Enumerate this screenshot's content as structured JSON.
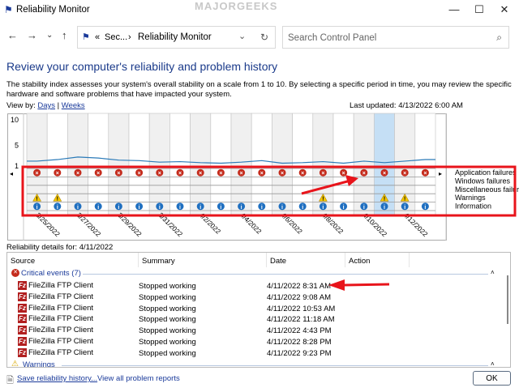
{
  "window": {
    "title": "Reliability Monitor",
    "minimize": "—",
    "maximize": "☐",
    "close": "✕",
    "watermark": "MAJORGEEKS .COM"
  },
  "nav": {
    "back": "←",
    "forward": "→",
    "recent": "⌄",
    "up": "↑",
    "breadcrumb_root": "«",
    "breadcrumb_parent": "Sec...",
    "breadcrumb_sep": "›",
    "breadcrumb_current": "Reliability Monitor",
    "dropdown": "⌄",
    "refresh": "↻",
    "search_placeholder": "Search Control Panel",
    "search_icon": "⌕"
  },
  "main": {
    "heading": "Review your computer's reliability and problem history",
    "description": "The stability index assesses your system's overall stability on a scale from 1 to 10. By selecting a specific period in time, you may review the specific hardware and software problems that have impacted your system.",
    "view_by_label": "View by:",
    "view_days": "Days",
    "view_sep": "|",
    "view_weeks": "Weeks",
    "last_updated": "Last updated: 4/13/2022 6:00 AM"
  },
  "chart_data": {
    "type": "line",
    "y_ticks": [
      "10",
      "5",
      "1"
    ],
    "ylim": [
      1,
      10
    ],
    "dates": [
      "3/25/2022",
      "3/26/2022",
      "3/27/2022",
      "3/28/2022",
      "3/29/2022",
      "3/30/2022",
      "3/31/2022",
      "4/1/2022",
      "4/2/2022",
      "4/3/2022",
      "4/4/2022",
      "4/5/2022",
      "4/6/2022",
      "4/7/2022",
      "4/8/2022",
      "4/9/2022",
      "4/10/2022",
      "4/11/2022",
      "4/12/2022",
      "4/13/2022"
    ],
    "date_labels": [
      "3/25/2022",
      "3/27/2022",
      "3/29/2022",
      "3/31/2022",
      "4/2/2022",
      "4/4/2022",
      "4/6/2022",
      "4/8/2022",
      "4/10/2022",
      "4/12/2022"
    ],
    "stability_index": [
      1.8,
      2.1,
      2.6,
      2.4,
      2.0,
      1.9,
      1.6,
      1.7,
      1.5,
      1.4,
      1.6,
      1.9,
      1.4,
      1.5,
      1.7,
      1.4,
      1.8,
      1.5,
      1.8,
      2.1
    ],
    "selected": "4/11/2022",
    "rows": [
      "Application failures",
      "Windows failures",
      "Miscellaneous failures",
      "Warnings",
      "Information"
    ],
    "application_failures": [
      1,
      1,
      1,
      1,
      1,
      1,
      1,
      1,
      1,
      1,
      1,
      1,
      1,
      1,
      1,
      1,
      1,
      1,
      1,
      1
    ],
    "warnings": [
      1,
      1,
      0,
      0,
      0,
      0,
      0,
      0,
      0,
      0,
      0,
      0,
      0,
      0,
      1,
      0,
      0,
      1,
      1,
      0
    ],
    "information": [
      1,
      1,
      1,
      1,
      1,
      1,
      1,
      1,
      1,
      1,
      1,
      1,
      1,
      1,
      1,
      1,
      1,
      1,
      1,
      1
    ],
    "colors": {
      "line": "#2a7ab8",
      "selected": "#c5dff5",
      "shaded": "#f0f0f0",
      "error": "#c42b1c",
      "info": "#1f6fc0",
      "warning": "#f2c500",
      "annotation": "#e8141b"
    }
  },
  "details": {
    "label": "Reliability details for: 4/11/2022",
    "columns": [
      "Source",
      "Summary",
      "Date",
      "Action"
    ],
    "critical_group": "Critical events (7)",
    "rows": [
      {
        "source": "FileZilla FTP Client",
        "summary": "Stopped working",
        "date": "4/11/2022 8:31 AM"
      },
      {
        "source": "FileZilla FTP Client",
        "summary": "Stopped working",
        "date": "4/11/2022 9:08 AM"
      },
      {
        "source": "FileZilla FTP Client",
        "summary": "Stopped working",
        "date": "4/11/2022 10:53 AM"
      },
      {
        "source": "FileZilla FTP Client",
        "summary": "Stopped working",
        "date": "4/11/2022 11:18 AM"
      },
      {
        "source": "FileZilla FTP Client",
        "summary": "Stopped working",
        "date": "4/11/2022 4:43 PM"
      },
      {
        "source": "FileZilla FTP Client",
        "summary": "Stopped working",
        "date": "4/11/2022 8:28 PM"
      },
      {
        "source": "FileZilla FTP Client",
        "summary": "Stopped working",
        "date": "4/11/2022 9:23 PM"
      }
    ],
    "warnings_group": "Warnings",
    "fz_glyph": "Fz"
  },
  "footer": {
    "save": "Save reliability history...",
    "view_all": "View all problem reports",
    "ok": "OK"
  }
}
